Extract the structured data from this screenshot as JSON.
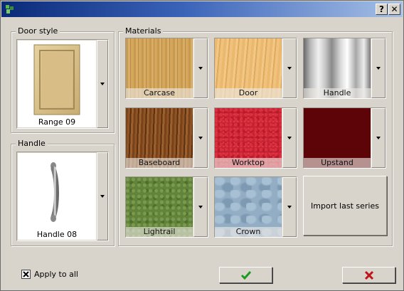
{
  "window": {
    "title": "",
    "help_label": "?",
    "close_label": "✕"
  },
  "door_style": {
    "group_label": "Door style",
    "selected": "Range 09"
  },
  "handle": {
    "group_label": "Handle",
    "selected": "Handle 08"
  },
  "materials": {
    "group_label": "Materials",
    "items": [
      {
        "label": "Carcase"
      },
      {
        "label": "Door"
      },
      {
        "label": "Handle"
      },
      {
        "label": "Baseboard"
      },
      {
        "label": "Worktop"
      },
      {
        "label": "Upstand"
      },
      {
        "label": "Lightrail"
      },
      {
        "label": "Crown"
      }
    ],
    "import_label": "Import last series"
  },
  "footer": {
    "apply_all_label": "Apply to all",
    "apply_all_checked": true
  },
  "colors": {
    "ok_check": "#1e9a1e",
    "cancel_x": "#c0141a",
    "title_start": "#0a2a78",
    "title_end": "#a6c0e6"
  }
}
